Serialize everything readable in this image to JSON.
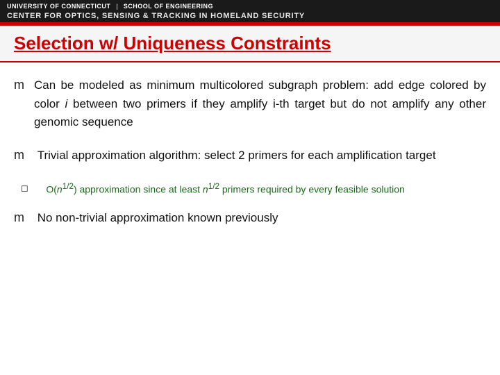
{
  "header": {
    "university": "UNIVERSITY OF CONNECTICUT",
    "divider": "|",
    "school": "SCHOOL OF ENGINEERING",
    "center": "CENTER FOR OPTICS, SENSING & TRACKING IN HOMELAND SECURITY"
  },
  "slide": {
    "title": "Selection w/ Uniqueness Constraints",
    "bullets": [
      {
        "symbol": "m",
        "text_parts": [
          {
            "text": "Can be modeled as minimum multicolored subgraph problem: add edge colored by color ",
            "italic": false
          },
          {
            "text": "i",
            "italic": true
          },
          {
            "text": " between two primers if they amplify i-th target but do not amplify any other genomic sequence",
            "italic": false
          }
        ],
        "sub_bullets": []
      },
      {
        "symbol": "m",
        "text_parts": [
          {
            "text": "Trivial approximation algorithm: select 2 primers for each amplification target",
            "italic": false
          }
        ],
        "sub_bullets": [
          {
            "symbol": "q",
            "text": "O(n1/2) approximation since at least n1/2 primers required by every feasible solution",
            "text_formatted": "O(n¹/²) approximation since at least n¹/² primers required by every feasible solution"
          }
        ]
      },
      {
        "symbol": "m",
        "text_parts": [
          {
            "text": "No non-trivial approximation known previously",
            "italic": false
          }
        ],
        "sub_bullets": []
      }
    ]
  }
}
